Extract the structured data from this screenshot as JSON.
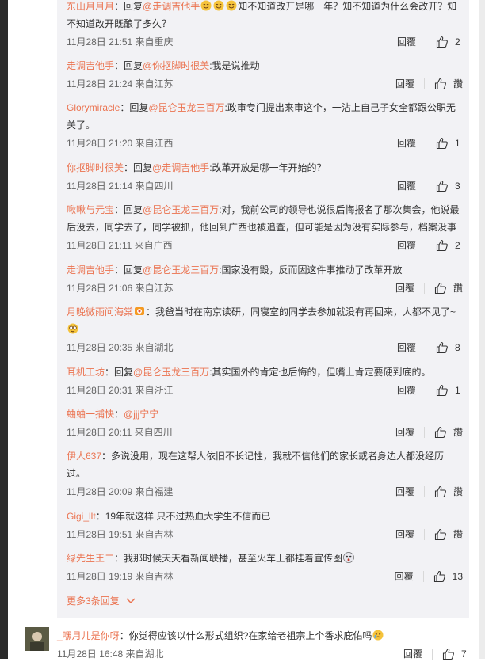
{
  "replies": [
    {
      "user": "东山月月月",
      "reply_label": "：回复",
      "mention": "@走调吉他手",
      "text_pre": "",
      "text": "知不知道改开是哪一年？知不知道为什么会改开？知不知道改开既酿了多久？",
      "time": "11月28日 21:51 来自重庆",
      "like": "2",
      "emoji_after_mention": 3
    },
    {
      "user": "走调吉他手",
      "reply_label": "：回复",
      "mention": "@你抠脚时很美",
      "text": ":我是说推动",
      "time": "11月28日 21:24 来自江苏",
      "like": "讚"
    },
    {
      "user": "Glorymiracle",
      "reply_label": "：回复",
      "mention": "@昆仑玉龙三百万",
      "text": ":政审专门提出来审这个，一沾上自己子女全都跟公职无关了。",
      "time": "11月28日 21:20 来自江西",
      "like": "1"
    },
    {
      "user": "你抠脚时很美",
      "reply_label": "：回复",
      "mention": "@走调吉他手",
      "text": ":改革开放是哪一年开始的？",
      "time": "11月28日 21:14 来自四川",
      "like": "3"
    },
    {
      "user": "啾啾与元宝",
      "reply_label": "：回复",
      "mention": "@昆仑玉龙三百万",
      "text": ":对，我前公司的领导也说很后悔报名了那次集会，他说最后没去，同学去了，同学被抓，他回到广西也被追查，但可能是因为没有实际参与，档案没事",
      "time": "11月28日 21:11 来自广西",
      "like": "2"
    },
    {
      "user": "走调吉他手",
      "reply_label": "：回复",
      "mention": "@昆仑玉龙三百万",
      "text": ":国家没有毁，反而因这件事推动了改革开放",
      "time": "11月28日 21:06 来自江苏",
      "like": "讚"
    },
    {
      "user": "月晚微雨问海棠",
      "reply_label": "",
      "mention": "",
      "text": "：我爸当时在南京读研，同寝室的同学去参加就没有再回来，人都不见了~",
      "time": "11月28日 20:35 来自湖北",
      "like": "8"
    },
    {
      "user": "耳机工坊",
      "reply_label": "：回复",
      "mention": "@昆仑玉龙三百万",
      "text": ":其实国外的肯定也后悔的，但嘴上肯定要硬到底的。",
      "time": "11月28日 20:31 来自浙江",
      "like": "1"
    },
    {
      "user": "蛐蛐一捕快",
      "reply_label": "：",
      "mention": "@jjj宁宁",
      "text": "",
      "time": "11月28日 20:11 来自四川",
      "like": "讚"
    },
    {
      "user": "伊人637",
      "reply_label": "",
      "mention": "",
      "text": "：多说没用，现在这帮人依旧不长记性，我就不信他们的家长或者身边人都没经历过。",
      "time": "11月28日 20:09 来自福建",
      "like": "讚"
    },
    {
      "user": "Gigi_llt",
      "reply_label": "",
      "mention": "",
      "text": "：19年就这样 只不过热血大学生不信而已",
      "time": "11月28日 19:51 来自吉林",
      "like": "讚"
    },
    {
      "user": "绿先生王二",
      "reply_label": "",
      "mention": "",
      "text": "：我那时候天天看新闻联播，甚至火车上都挂着宣传图",
      "time": "11月28日 19:19 来自吉林",
      "like": "13"
    }
  ],
  "reply_btn": "回覆",
  "more_replies": "更多3条回复",
  "main_comment": {
    "user": "_嘿月儿是你呀",
    "text": "：你觉得应该以什么形式组织?在家给老祖宗上个香求庇佑吗",
    "time": "11月28日 16:48 来自湖北",
    "reply_btn": "回覆",
    "like": "7"
  },
  "colors": {
    "accent": "#eb7350",
    "panel": "#f2f2f5"
  }
}
